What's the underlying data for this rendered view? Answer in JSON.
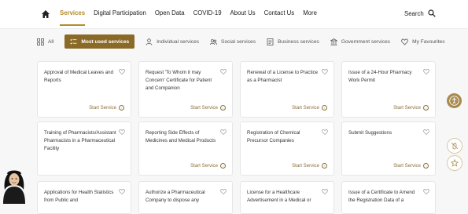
{
  "nav": {
    "items": [
      "Services",
      "Digital Participation",
      "Open Data",
      "COVID-19",
      "About Us",
      "Contact Us",
      "More"
    ],
    "search_label": "Search"
  },
  "filters": [
    {
      "label": "All",
      "icon": "grid-icon"
    },
    {
      "label": "Most used services",
      "icon": "list-check-icon"
    },
    {
      "label": "Individual services",
      "icon": "person-icon"
    },
    {
      "label": "Social services",
      "icon": "people-icon"
    },
    {
      "label": "Business services",
      "icon": "document-icon"
    },
    {
      "label": "Government services",
      "icon": "building-icon"
    },
    {
      "label": "My Favourites",
      "icon": "heart-icon"
    }
  ],
  "cards": [
    {
      "title": "Approval of Medical Leaves and Reports",
      "action": "Start Service"
    },
    {
      "title": "Request 'To Whom it may Concern' Certificate for Patient and Companion",
      "action": "Start Service"
    },
    {
      "title": "Renewal of a License to Practice as a Pharmacist",
      "action": "Start Service"
    },
    {
      "title": "Issue of a 24-Hour Pharmacy Work Permit",
      "action": "Start Service"
    },
    {
      "title": "Training of Pharmacists/Assistant Pharmacists in a Pharmaceutical Facility",
      "action": "Start Service"
    },
    {
      "title": "Reporting Side Effects of Medicines and Medical Products",
      "action": "Start Service"
    },
    {
      "title": "Registration of Chemical Precursor Companies",
      "action": "Start Service"
    },
    {
      "title": "Submit Suggestions",
      "action": "Start Service"
    },
    {
      "title": "Applications for Health Statistics from Public and",
      "action": ""
    },
    {
      "title": "Authorize a Pharmaceutical Company to dispose any",
      "action": ""
    },
    {
      "title": "License for a Healthcare Advertisement in a Medical or",
      "action": ""
    },
    {
      "title": "Issue of a Certificate to Amend the Registration Data of a",
      "action": ""
    }
  ],
  "colors": {
    "accent": "#b68a2e",
    "active_filter": "#8a6a26"
  }
}
